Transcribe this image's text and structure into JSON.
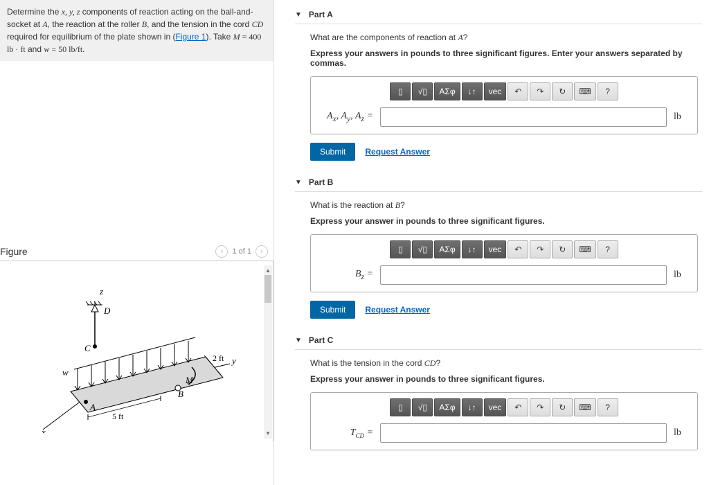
{
  "problem": {
    "text_prefix": "Determine the ",
    "xyz": "x, y, z",
    "text_mid1": " components of reaction acting on the ball-and-socket at ",
    "A": "A",
    "text_mid2": ", the reaction at the roller ",
    "B": "B",
    "text_mid3": ", and the tension in the cord ",
    "CD": "CD",
    "text_mid4": " required for equilibrium of the plate shown in (",
    "figlink": "Figure 1",
    "text_mid5": "). Take ",
    "M": "M",
    "eq1": " = 400 lb · ft",
    "and": " and ",
    "w": "w",
    "eq2": " = 50 lb/ft."
  },
  "figure": {
    "heading": "Figure",
    "counter": "1 of 1",
    "labels": {
      "A": "A",
      "B": "B",
      "C": "C",
      "D": "D",
      "M": "M",
      "w": "w",
      "x": "x",
      "y": "y",
      "z": "z",
      "dim5": "5 ft",
      "dim2": "2 ft"
    }
  },
  "toolbar": {
    "tpl_icon": "▯",
    "frac_icon": "√▯",
    "greek": "ΑΣφ",
    "arrows": "↓↑",
    "vec": "vec",
    "undo": "↶",
    "redo": "↷",
    "reset": "↻",
    "keybd": "⌨",
    "help": "?"
  },
  "parts": {
    "A": {
      "title": "Part A",
      "question_pre": "What are the components of reaction at ",
      "question_var": "A",
      "question_post": "?",
      "instructions": "Express your answers in pounds to three significant figures. Enter your answers separated by commas.",
      "var_label": "Aₓ, Aᵧ, A_z =",
      "unit": "lb",
      "submit": "Submit",
      "request": "Request Answer"
    },
    "B": {
      "title": "Part B",
      "question_pre": "What is the reaction at ",
      "question_var": "B",
      "question_post": "?",
      "instructions": "Express your answer in pounds to three significant figures.",
      "var_label": "B_z =",
      "unit": "lb",
      "submit": "Submit",
      "request": "Request Answer"
    },
    "C": {
      "title": "Part C",
      "question_pre": "What is the tension in the cord ",
      "question_var": "CD",
      "question_post": "?",
      "instructions": "Express your answer in pounds to three significant figures.",
      "var_label": "T_CD =",
      "unit": "lb"
    }
  }
}
